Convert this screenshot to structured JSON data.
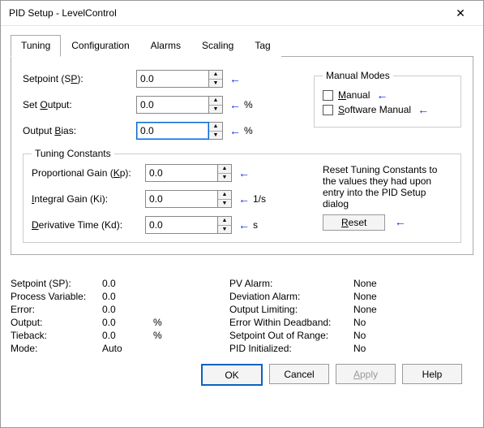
{
  "window": {
    "title": "PID Setup - LevelControl"
  },
  "tabs": {
    "t0": "Tuning",
    "t1": "Configuration",
    "t2": "Alarms",
    "t3": "Scaling",
    "t4": "Tag"
  },
  "tuning": {
    "setpoint_label_pre": "Setpoint (S",
    "setpoint_label_u": "P",
    "setpoint_label_post": "):",
    "setpoint_value": "0.0",
    "set_output_label_pre": "Set ",
    "set_output_label_u": "O",
    "set_output_label_post": "utput:",
    "set_output_value": "0.0",
    "set_output_unit": "%",
    "output_bias_label_pre": "Output ",
    "output_bias_label_u": "B",
    "output_bias_label_post": "ias:",
    "output_bias_value": "0.0",
    "output_bias_unit": "%"
  },
  "manual_modes": {
    "legend": "Manual Modes",
    "manual_u": "M",
    "manual_post": "anual",
    "sw_u": "S",
    "sw_post": "oftware Manual"
  },
  "tc": {
    "legend": "Tuning Constants",
    "kp_label_pre": "Proportional Gain (",
    "kp_label_u": "K",
    "kp_label_post": "p):",
    "kp_value": "0.0",
    "ki_label_pre": "",
    "ki_label_u": "I",
    "ki_label_post": "ntegral Gain (Ki):",
    "ki_value": "0.0",
    "ki_unit": "1/s",
    "kd_label_pre": "",
    "kd_label_u": "D",
    "kd_label_post": "erivative Time (Kd):",
    "kd_value": "0.0",
    "kd_unit": "s",
    "reset_note": "Reset Tuning Constants to the values they had upon entry into the PID Setup dialog",
    "reset_u": "R",
    "reset_post": "eset"
  },
  "status_left": {
    "r1l": "Setpoint (SP):",
    "r1v": "0.0",
    "r2l": "Process Variable:",
    "r2v": "0.0",
    "r3l": "Error:",
    "r3v": "0.0",
    "r4l": "Output:",
    "r4v": "0.0",
    "r4u": "%",
    "r5l": "Tieback:",
    "r5v": "0.0",
    "r5u": "%",
    "r6l": "Mode:",
    "r6v": "Auto"
  },
  "status_right": {
    "r1l": "PV Alarm:",
    "r1v": "None",
    "r2l": "Deviation Alarm:",
    "r2v": "None",
    "r3l": "Output Limiting:",
    "r3v": "None",
    "r4l": "Error Within Deadband:",
    "r4v": "No",
    "r5l": "Setpoint Out of Range:",
    "r5v": "No",
    "r6l": "PID Initialized:",
    "r6v": "No"
  },
  "buttons": {
    "ok": "OK",
    "cancel": "Cancel",
    "apply_u": "A",
    "apply_post": "pply",
    "help": "Help"
  },
  "glyphs": {
    "arrow": "←",
    "up": "▲",
    "down": "▼",
    "x": "✕"
  }
}
